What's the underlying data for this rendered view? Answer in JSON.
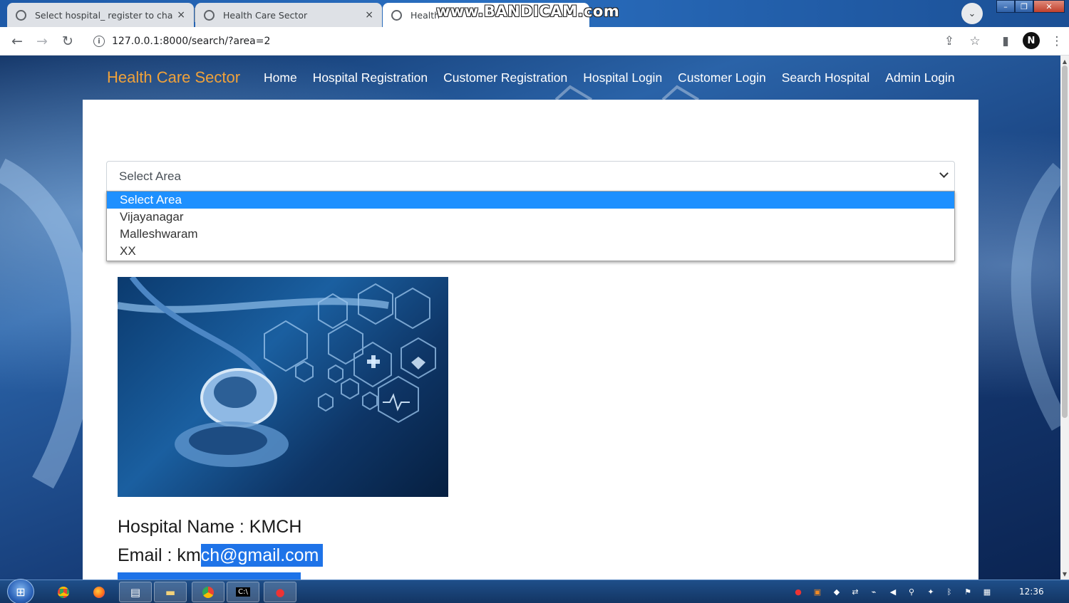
{
  "browser": {
    "tabs": [
      {
        "title": "Select hospital_ register to chang",
        "close": "×"
      },
      {
        "title": "Health Care Sector",
        "close": "×"
      },
      {
        "title": "Health"
      }
    ],
    "watermark": "www.BANDICAM.com",
    "url": "127.0.0.1:8000/search/?area=2",
    "profile_initial": "N"
  },
  "navbar": {
    "brand": "Health Care Sector",
    "links": [
      "Home",
      "Hospital Registration",
      "Customer Registration",
      "Hospital Login",
      "Customer Login",
      "Search Hospital",
      "Admin Login"
    ]
  },
  "area_select": {
    "value": "Select Area",
    "options": [
      "Select Area",
      "Vijayanagar",
      "Malleshwaram",
      "XX"
    ],
    "selected_index": 0
  },
  "hospital": {
    "name_line": "Hospital Name : KMCH",
    "email_prefix": "Email : km",
    "email_highlighted": "ch@gmail.com"
  },
  "taskbar": {
    "clock": "12:36"
  },
  "colors": {
    "brand": "#f0a23a",
    "option_highlight": "#1e90ff",
    "text_selection": "#1e73e8"
  }
}
